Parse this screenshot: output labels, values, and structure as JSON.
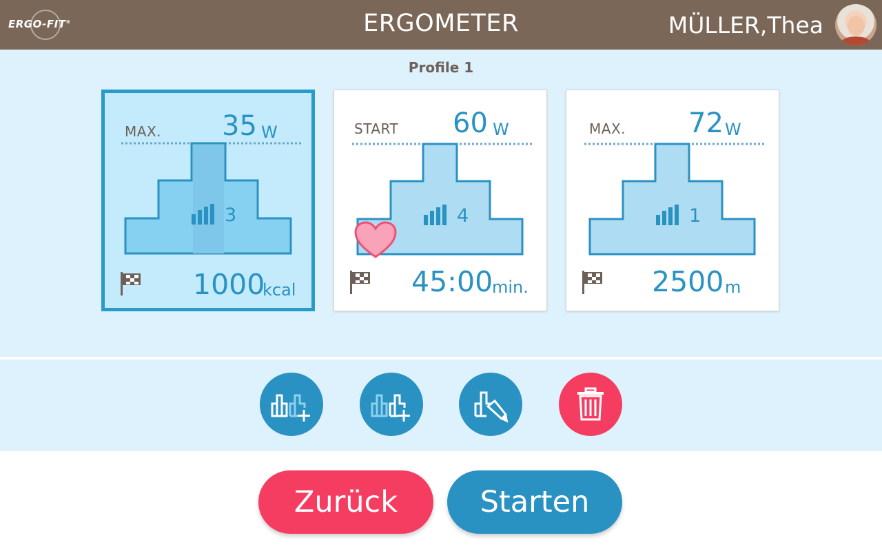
{
  "header": {
    "logo_text": "ERGO-FIT",
    "logo_mark": "®",
    "title": "ERGOMETER",
    "user_name": "MÜLLER,Thea"
  },
  "profile_title": "Profile 1",
  "cards": [
    {
      "selected": true,
      "top_label": "MAX.",
      "top_value": "35",
      "top_unit": "W",
      "level": "3",
      "goal_value": "1000",
      "goal_unit": "kcal",
      "heart": false
    },
    {
      "selected": false,
      "top_label": "START",
      "top_value": "60",
      "top_unit": "W",
      "level": "4",
      "goal_value": "45:00",
      "goal_unit": "min.",
      "heart": true
    },
    {
      "selected": false,
      "top_label": "MAX.",
      "top_value": "72",
      "top_unit": "W",
      "level": "1",
      "goal_value": "2500",
      "goal_unit": "m",
      "heart": false
    }
  ],
  "toolbar": {
    "buttons": [
      "add-profile-icon",
      "copy-profile-icon",
      "edit-profile-icon",
      "trash-icon"
    ]
  },
  "actions": {
    "back_label": "Zurück",
    "start_label": "Starten"
  },
  "colors": {
    "header_bg": "#7a6758",
    "accent_blue": "#2a92c3",
    "accent_red": "#f53d61",
    "panel_bg": "#ddf2fd",
    "selected_card_bg": "#c3ebfc"
  }
}
